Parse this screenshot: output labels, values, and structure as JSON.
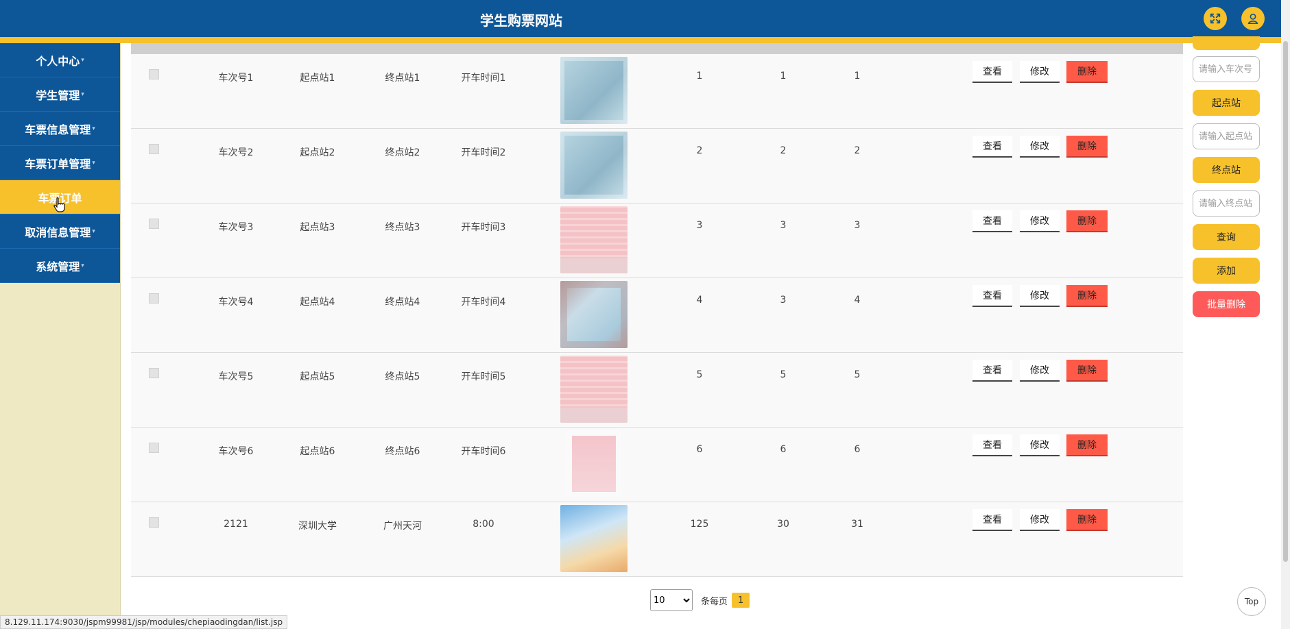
{
  "header": {
    "title": "学生购票网站",
    "fullscreen_icon": "expand-icon",
    "user_icon": "user-icon"
  },
  "sidebar": {
    "items": [
      {
        "label": "个人中心",
        "caret": "▾",
        "active": false
      },
      {
        "label": "学生管理",
        "caret": "▾",
        "active": false
      },
      {
        "label": "车票信息管理",
        "caret": "▾",
        "active": false
      },
      {
        "label": "车票订单管理",
        "caret": "▾",
        "active": false
      },
      {
        "label": "车票订单",
        "caret": "",
        "active": true
      },
      {
        "label": "取消信息管理",
        "caret": "▾",
        "active": false
      },
      {
        "label": "系统管理",
        "caret": "▾",
        "active": false
      }
    ]
  },
  "table": {
    "rows": [
      {
        "train": "车次号1",
        "from": "起点站1",
        "to": "终点站1",
        "time": "开车时间1",
        "image": "ticket-photo-blue",
        "a": "1",
        "b": "1",
        "c": "1"
      },
      {
        "train": "车次号2",
        "from": "起点站2",
        "to": "终点站2",
        "time": "开车时间2",
        "image": "ticket-photo-blue",
        "a": "2",
        "b": "2",
        "c": "2"
      },
      {
        "train": "车次号3",
        "from": "起点站3",
        "to": "终点站3",
        "time": "开车时间3",
        "image": "ticket-photo-pink",
        "a": "3",
        "b": "3",
        "c": "3"
      },
      {
        "train": "车次号4",
        "from": "起点站4",
        "to": "终点站4",
        "time": "开车时间4",
        "image": "ticket-photo-blue2",
        "a": "4",
        "b": "3",
        "c": "4"
      },
      {
        "train": "车次号5",
        "from": "起点站5",
        "to": "终点站5",
        "time": "开车时间5",
        "image": "ticket-photo-pink",
        "a": "5",
        "b": "5",
        "c": "5"
      },
      {
        "train": "车次号6",
        "from": "起点站6",
        "to": "终点站6",
        "time": "开车时间6",
        "image": "ticket-photo-pink2",
        "a": "6",
        "b": "6",
        "c": "6"
      },
      {
        "train": "2121",
        "from": "深圳大学",
        "to": "广州天河",
        "time": "8:00",
        "image": "train-photo",
        "a": "125",
        "b": "30",
        "c": "31"
      }
    ],
    "actions": {
      "view": "查看",
      "edit": "修改",
      "delete": "删除"
    }
  },
  "search_panel": {
    "train_placeholder": "请输入车次号",
    "from_label": "起点站",
    "from_placeholder": "请输入起点站",
    "to_label": "终点站",
    "to_placeholder": "请输入终点站",
    "query_button": "查询",
    "add_button": "添加",
    "batch_delete_button": "批量删除"
  },
  "pagination": {
    "page_size": "10",
    "options": [
      "10"
    ],
    "per_page_label": "条每页",
    "current_page": "1"
  },
  "top_button": "Top",
  "status_url": "8.129.11.174:9030/jspm99981/jsp/modules/chepiaodingdan/list.jsp",
  "colors": {
    "primary": "#0d5698",
    "accent": "#f7c12c",
    "danger": "#ff5a47",
    "sidebar_bg": "#efe9c3"
  }
}
